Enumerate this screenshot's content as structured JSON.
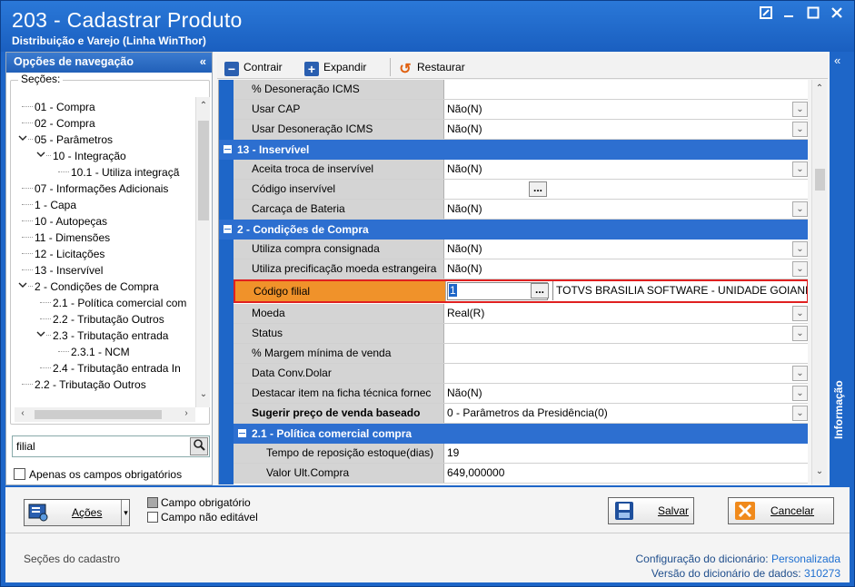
{
  "window": {
    "title": "203 - Cadastrar  Produto",
    "subtitle": "Distribuição e Varejo (Linha WinThor)"
  },
  "nav": {
    "header": "Opções de navegação",
    "collapse": "«",
    "sections_label": "Seções:",
    "tree": [
      {
        "label": "01 - Compra",
        "level": 0,
        "expander": ""
      },
      {
        "label": "02 - Compra",
        "level": 0,
        "expander": ""
      },
      {
        "label": "05 - Parâmetros",
        "level": 0,
        "expander": "v"
      },
      {
        "label": "10 - Integração",
        "level": 1,
        "expander": "v"
      },
      {
        "label": "10.1 - Utiliza integraçã",
        "level": 2,
        "expander": ""
      },
      {
        "label": "07 - Informações Adicionais",
        "level": 0,
        "expander": ""
      },
      {
        "label": "1 - Capa",
        "level": 0,
        "expander": ""
      },
      {
        "label": "10 - Autopeças",
        "level": 0,
        "expander": ""
      },
      {
        "label": "11 - Dimensões",
        "level": 0,
        "expander": ""
      },
      {
        "label": "12 - Licitações",
        "level": 0,
        "expander": ""
      },
      {
        "label": "13 - Inservível",
        "level": 0,
        "expander": ""
      },
      {
        "label": "2 - Condições de Compra",
        "level": 0,
        "expander": "v"
      },
      {
        "label": "2.1 - Política comercial com",
        "level": 1,
        "expander": ""
      },
      {
        "label": "2.2 - Tributação Outros",
        "level": 1,
        "expander": ""
      },
      {
        "label": "2.3 - Tributação entrada",
        "level": 1,
        "expander": "v"
      },
      {
        "label": "2.3.1 - NCM",
        "level": 2,
        "expander": ""
      },
      {
        "label": "2.4 - Tributação entrada In",
        "level": 1,
        "expander": ""
      },
      {
        "label": "2.2 - Tributação Outros",
        "level": 0,
        "expander": ""
      }
    ],
    "search_value": "filial",
    "only_required_label": "Apenas os campos obrigatórios"
  },
  "toolbar": {
    "collapse_label": "Contrair",
    "expand_label": "Expandir",
    "restore_label": "Restaurar"
  },
  "grid": {
    "rows": [
      {
        "type": "field",
        "label": "% Desoneração ICMS",
        "value": "",
        "control": "none"
      },
      {
        "type": "field",
        "label": "Usar CAP",
        "value": "Não(N)",
        "control": "dropdown"
      },
      {
        "type": "field",
        "label": "Usar Desoneração ICMS",
        "value": "Não(N)",
        "control": "dropdown"
      },
      {
        "type": "category",
        "label": "13 - Inservível"
      },
      {
        "type": "field",
        "label": "Aceita troca de inservível",
        "value": "Não(N)",
        "control": "dropdown"
      },
      {
        "type": "field",
        "label": "Código inservível",
        "value": "",
        "control": "ellipsis"
      },
      {
        "type": "field",
        "label": "Carcaça de Bateria",
        "value": "Não(N)",
        "control": "dropdown"
      },
      {
        "type": "category",
        "label": "2 - Condições de Compra"
      },
      {
        "type": "field",
        "label": "Utiliza compra consignada",
        "value": "Não(N)",
        "control": "dropdown"
      },
      {
        "type": "field",
        "label": "Utiliza precificação moeda estrangeira",
        "value": "Não(N)",
        "control": "dropdown"
      },
      {
        "type": "selected",
        "label": "Código filial",
        "value": "1",
        "extra": "TOTVS BRASILIA SOFTWARE - UNIDADE GOIANI",
        "control": "ellipsis"
      },
      {
        "type": "field",
        "label": "Moeda",
        "value": "Real(R)",
        "control": "dropdown"
      },
      {
        "type": "field",
        "label": "Status",
        "value": "",
        "control": "dropdown"
      },
      {
        "type": "field",
        "label": "% Margem mínima de venda",
        "value": "",
        "control": "none"
      },
      {
        "type": "field",
        "label": "Data Conv.Dolar",
        "value": "",
        "control": "dropdown"
      },
      {
        "type": "field",
        "label": "Destacar item na ficha técnica fornec",
        "value": "Não(N)",
        "control": "dropdown"
      },
      {
        "type": "bold",
        "label": "Sugerir preço de venda baseado",
        "value": "0 - Parâmetros da Presidência(0)",
        "control": "dropdown"
      },
      {
        "type": "subcategory",
        "label": "2.1 - Política comercial compra"
      },
      {
        "type": "subfield",
        "label": "Tempo de reposição estoque(dias)",
        "value": "19",
        "control": "none"
      },
      {
        "type": "subfield",
        "label": "Valor Ult.Compra",
        "value": "649,000000",
        "control": "none"
      }
    ]
  },
  "info_panel": {
    "label": "Informação",
    "collapse": "«"
  },
  "bottom": {
    "actions_label": "Ações",
    "legend_required": "Campo obrigatório",
    "legend_not_editable": "Campo não editável",
    "save_label": "Salvar",
    "cancel_label": "Cancelar",
    "sections_label": "Seções do cadastro",
    "dict_config_label": "Configuração do dicionário:",
    "dict_config_value": "Personalizada",
    "dict_version_label": "Versão do dicionário de dados:",
    "dict_version_value": "310273"
  },
  "colors": {
    "window_blue": "#1e66c8",
    "category_blue": "#2d6fd0",
    "selected_orange": "#f0922a",
    "selected_border": "#e02020"
  }
}
